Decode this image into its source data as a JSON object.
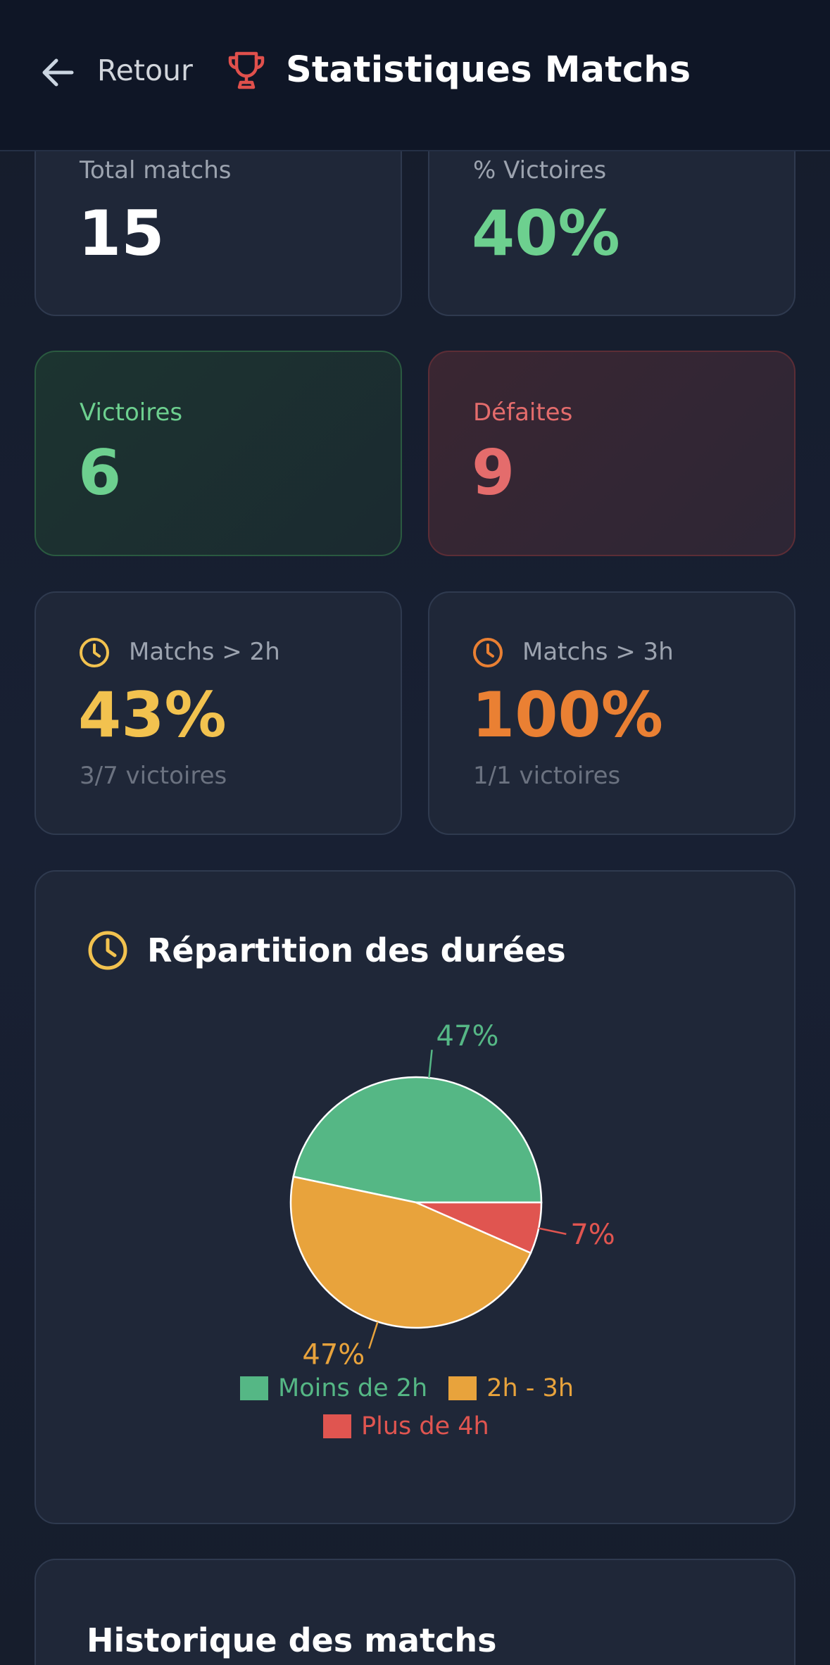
{
  "header": {
    "back_label": "Retour",
    "title": "Statistiques Matchs"
  },
  "stats": {
    "total": {
      "label": "Total matchs",
      "value": "15"
    },
    "win_pct": {
      "label": "% Victoires",
      "value": "40%"
    },
    "wins": {
      "label": "Victoires",
      "value": "6"
    },
    "losses": {
      "label": "Défaites",
      "value": "9"
    },
    "over_2h": {
      "label": "Matchs > 2h",
      "value": "43%",
      "detail": "3/7 victoires"
    },
    "over_3h": {
      "label": "Matchs > 3h",
      "value": "100%",
      "detail": "1/1 victoires"
    }
  },
  "duration_section": {
    "title": "Répartition des durées"
  },
  "chart_data": {
    "type": "pie",
    "series": [
      {
        "name": "Moins de 2h",
        "value": 46.7,
        "label": "47%",
        "color": "#55b785"
      },
      {
        "name": "2h - 3h",
        "value": 46.7,
        "label": "47%",
        "color": "#e8a33c"
      },
      {
        "name": "Plus de 4h",
        "value": 6.6,
        "label": "7%",
        "color": "#e05550"
      }
    ],
    "legend_position": "bottom"
  },
  "history_section": {
    "title": "Historique des matchs"
  },
  "colors": {
    "green": "#6dd08f",
    "red": "#e46c6c",
    "yellow": "#f2c24f",
    "orange": "#ea8033",
    "trophy": "#e0504c"
  },
  "icons": {
    "back": "arrow-left-icon",
    "trophy": "trophy-icon",
    "clock": "clock-icon"
  }
}
